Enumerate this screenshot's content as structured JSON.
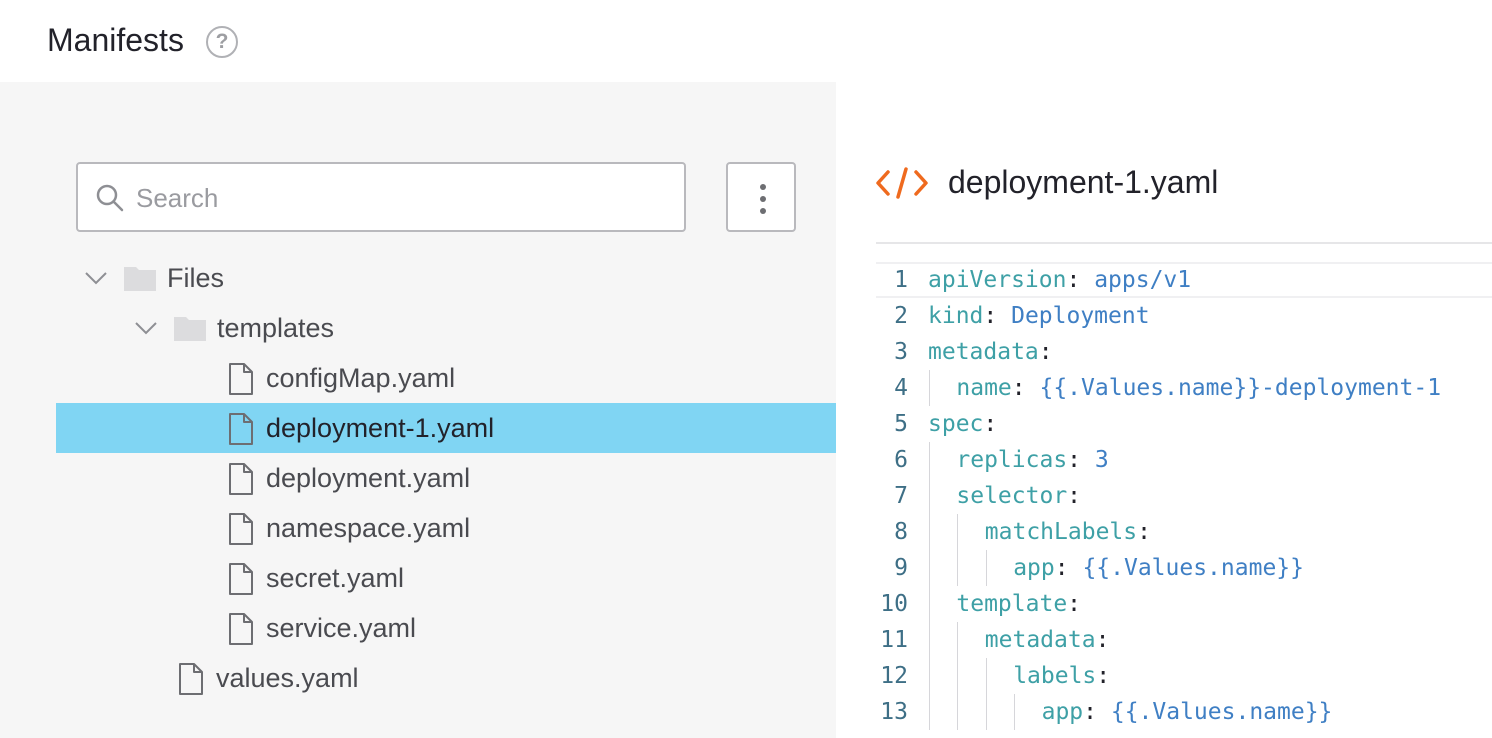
{
  "header": {
    "title": "Manifests",
    "help_icon": "question-circle-icon",
    "help_glyph": "?"
  },
  "search": {
    "placeholder": "Search",
    "value": ""
  },
  "menu": {
    "icon": "vertical-dots-icon"
  },
  "tree": [
    {
      "label": "Files",
      "type": "folder",
      "expanded": true,
      "depth": 0
    },
    {
      "label": "templates",
      "type": "folder",
      "expanded": true,
      "depth": 1
    },
    {
      "label": "configMap.yaml",
      "type": "file",
      "depth": 2
    },
    {
      "label": "deployment-1.yaml",
      "type": "file",
      "depth": 2,
      "selected": true
    },
    {
      "label": "deployment.yaml",
      "type": "file",
      "depth": 2
    },
    {
      "label": "namespace.yaml",
      "type": "file",
      "depth": 2
    },
    {
      "label": "secret.yaml",
      "type": "file",
      "depth": 2
    },
    {
      "label": "service.yaml",
      "type": "file",
      "depth": 2
    },
    {
      "label": "values.yaml",
      "type": "file",
      "depth": 1
    }
  ],
  "editor": {
    "file_icon": "code-brackets-icon",
    "file_name": "deployment-1.yaml",
    "active_line": 1,
    "lines": [
      {
        "n": "1",
        "indent": 0,
        "key": "apiVersion",
        "sep": ": ",
        "val": "apps/v1"
      },
      {
        "n": "2",
        "indent": 0,
        "key": "kind",
        "sep": ": ",
        "val": "Deployment"
      },
      {
        "n": "3",
        "indent": 0,
        "key": "metadata",
        "sep": ":",
        "val": ""
      },
      {
        "n": "4",
        "indent": 1,
        "key": "name",
        "sep": ": ",
        "val": "{{.Values.name}}-deployment-1"
      },
      {
        "n": "5",
        "indent": 0,
        "key": "spec",
        "sep": ":",
        "val": ""
      },
      {
        "n": "6",
        "indent": 1,
        "key": "replicas",
        "sep": ": ",
        "val": "3"
      },
      {
        "n": "7",
        "indent": 1,
        "key": "selector",
        "sep": ":",
        "val": ""
      },
      {
        "n": "8",
        "indent": 2,
        "key": "matchLabels",
        "sep": ":",
        "val": ""
      },
      {
        "n": "9",
        "indent": 3,
        "key": "app",
        "sep": ": ",
        "val": "{{.Values.name}}"
      },
      {
        "n": "10",
        "indent": 1,
        "key": "template",
        "sep": ":",
        "val": ""
      },
      {
        "n": "11",
        "indent": 2,
        "key": "metadata",
        "sep": ":",
        "val": ""
      },
      {
        "n": "12",
        "indent": 3,
        "key": "labels",
        "sep": ":",
        "val": ""
      },
      {
        "n": "13",
        "indent": 4,
        "key": "app",
        "sep": ": ",
        "val": "{{.Values.name}}"
      }
    ]
  },
  "colors": {
    "selected_row": "#80d5f3",
    "code_key": "#3ea0a6",
    "code_value": "#3f7fc4",
    "code_icon": "#ef6a1e",
    "line_number": "#3e6f86"
  }
}
